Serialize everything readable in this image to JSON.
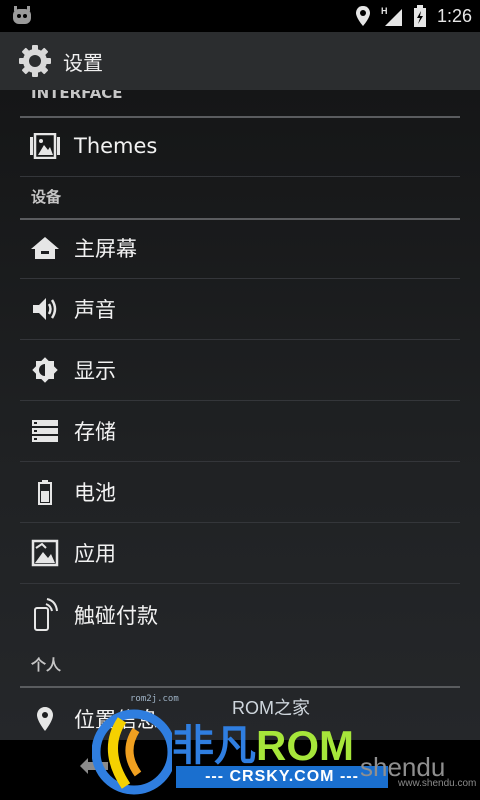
{
  "status_bar": {
    "time": "1:26",
    "icons": [
      "cyanogenmod-icon",
      "location-icon",
      "signal-icon",
      "battery-icon"
    ],
    "network_label": "H"
  },
  "action_bar": {
    "title": "设置",
    "icon": "gear-icon"
  },
  "sections": [
    {
      "header": "INTERFACE",
      "items": [
        {
          "label": "Themes",
          "icon": "themes-icon"
        }
      ]
    },
    {
      "header": "设备",
      "items": [
        {
          "label": "主屏幕",
          "icon": "home-icon"
        },
        {
          "label": "声音",
          "icon": "sound-icon"
        },
        {
          "label": "显示",
          "icon": "display-icon"
        },
        {
          "label": "存储",
          "icon": "storage-icon"
        },
        {
          "label": "电池",
          "icon": "battery-icon"
        },
        {
          "label": "应用",
          "icon": "apps-icon"
        },
        {
          "label": "触碰付款",
          "icon": "nfc-payment-icon"
        }
      ]
    },
    {
      "header": "个人",
      "items": [
        {
          "label": "位置信息",
          "icon": "location-icon"
        }
      ]
    }
  ],
  "watermarks": {
    "rom2j": "rom2j.com",
    "romhome": "ROM之家",
    "feifan_cn": "非凡",
    "feifan_rom": "ROM",
    "crsky": "--- CRSKY.COM ---",
    "shendu": "shendu",
    "shendu_url": "www.shendu.com"
  },
  "colors": {
    "background": "#1a1b1d",
    "action_bar": "#2b2d2f",
    "divider": "#5a5c5f",
    "text": "#f2f2f2"
  }
}
